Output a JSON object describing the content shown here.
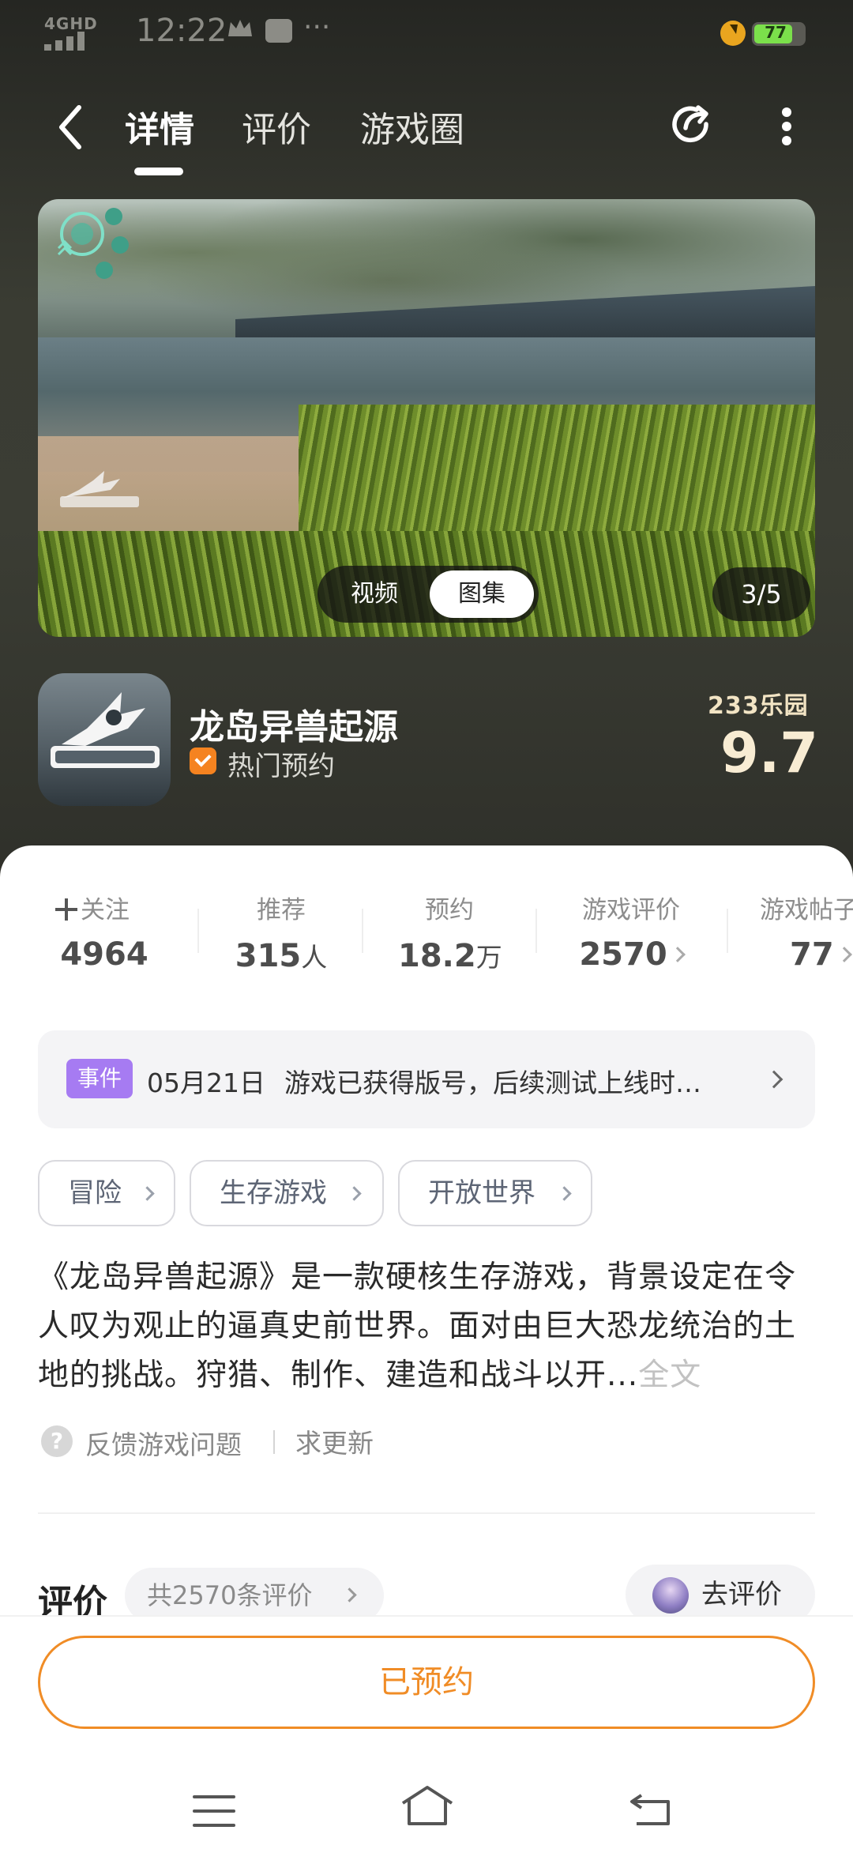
{
  "status_bar": {
    "network": "4GHD",
    "time": "12:22",
    "more": "···",
    "battery": "77",
    "battery_level": 0.77
  },
  "nav": {
    "tabs": [
      {
        "label": "详情",
        "active": true
      },
      {
        "label": "评价",
        "active": false
      },
      {
        "label": "游戏圈",
        "active": false
      }
    ],
    "icons": [
      "back-arrow-icon",
      "share-icon",
      "more-vertical-icon"
    ]
  },
  "banner": {
    "segments": [
      {
        "label": "视频",
        "selected": false
      },
      {
        "label": "图集",
        "selected": true
      }
    ],
    "counter": "3/5"
  },
  "game": {
    "title": "龙岛异兽起源",
    "badge_text": "热门预约",
    "score_brand": "233乐园",
    "score": "9.7"
  },
  "stats": [
    {
      "label": "关注",
      "value": "4964",
      "unit": ""
    },
    {
      "label": "推荐",
      "value": "315",
      "unit": "人"
    },
    {
      "label": "预约",
      "value": "18.2",
      "unit": "万"
    },
    {
      "label": "游戏评价",
      "value": "2570",
      "unit": ""
    },
    {
      "label": "游戏帖子",
      "value": "77",
      "unit": ""
    }
  ],
  "event": {
    "tag": "事件",
    "date": "05月21日",
    "text": "游戏已获得版号，后续测试上线时…"
  },
  "tags": [
    "冒险",
    "生存游戏",
    "开放世界"
  ],
  "description": {
    "text": "《龙岛异兽起源》是一款硬核生存游戏，背景设定在令人叹为观止的逼真史前世界。面对由巨大恐龙统治的土地的挑战。狩猎、制作、建造和战斗以开...",
    "more": "全文"
  },
  "links": {
    "feedback": "反馈游戏问题",
    "update": "求更新"
  },
  "review": {
    "title": "评价",
    "count": "共2570条评价",
    "write": "去评价"
  },
  "action": {
    "reserve": "已预约"
  },
  "colors": {
    "accent": "#f08c26",
    "event_tag": "#a67bf2",
    "score": "#f8ecd3"
  }
}
